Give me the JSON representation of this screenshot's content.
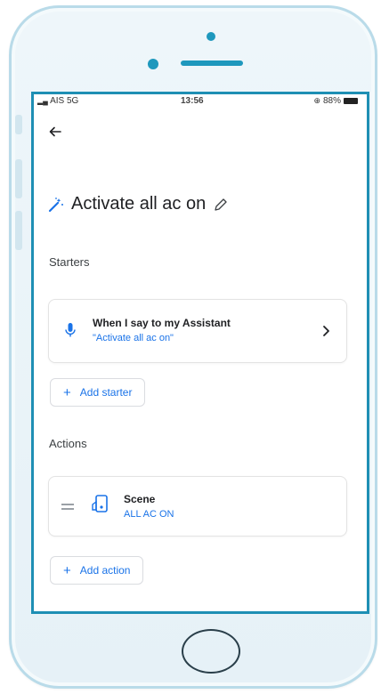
{
  "status_bar": {
    "carrier": "AIS 5G",
    "time": "13:56",
    "battery": "88%"
  },
  "routine": {
    "title": "Activate all ac on"
  },
  "starters": {
    "heading": "Starters",
    "item": {
      "title": "When I say to my Assistant",
      "subtitle": "\"Activate all ac on\""
    },
    "add_label": "Add starter"
  },
  "actions": {
    "heading": "Actions",
    "item": {
      "title": "Scene",
      "subtitle": "ALL AC ON"
    },
    "add_label": "Add action"
  },
  "colors": {
    "accent": "#1a73e8",
    "frame": "#1e8fb4"
  }
}
